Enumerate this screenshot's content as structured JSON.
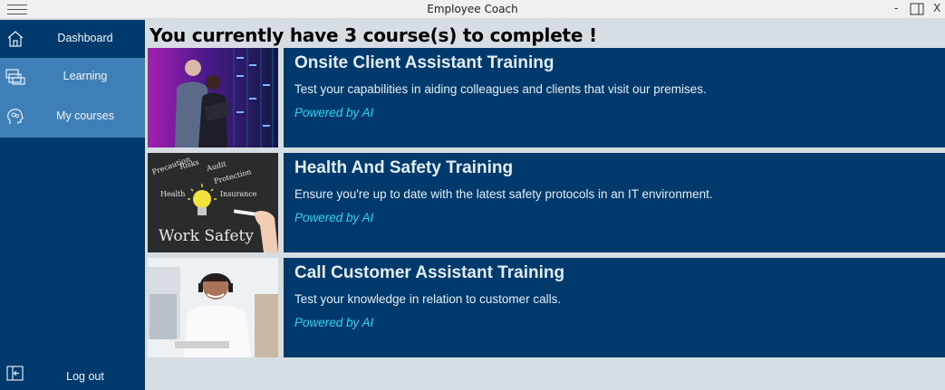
{
  "window": {
    "title": "Employee Coach",
    "minimize": "-",
    "close": "X"
  },
  "sidebar": {
    "items": [
      {
        "label": "Dashboard",
        "icon": "home-icon"
      },
      {
        "label": "Learning",
        "icon": "learning-icon"
      },
      {
        "label": "My courses",
        "icon": "my-courses-icon"
      }
    ],
    "logout": {
      "label": "Log out",
      "icon": "logout-icon"
    }
  },
  "main": {
    "heading": "You currently have 3 course(s) to complete !",
    "courses": [
      {
        "title": "Onsite Client Assistant Training",
        "description": "Test your capabilities in aiding colleagues and clients that visit our premises.",
        "tag": "Powered by AI",
        "image": "server-room-photo"
      },
      {
        "title": "Health And Safety Training",
        "description": "Ensure you're up to date with the latest safety protocols in an IT environment.",
        "tag": "Powered by AI",
        "image": "work-safety-chalkboard",
        "image_text": {
          "words": [
            "Precaution",
            "Risks",
            "Audit",
            "Protection",
            "Health",
            "Insurance",
            "Work Safety"
          ]
        }
      },
      {
        "title": "Call Customer Assistant Training",
        "description": "Test your knowledge in relation to customer calls.",
        "tag": "Powered by AI",
        "image": "call-center-agent-photo"
      }
    ]
  },
  "colors": {
    "sidebar_bg": "#003a6d",
    "sidebar_active": "#3e7fb8",
    "card_bg": "#003a6d",
    "ai_tag": "#27d3f0",
    "page_bg": "#d6dde3"
  }
}
